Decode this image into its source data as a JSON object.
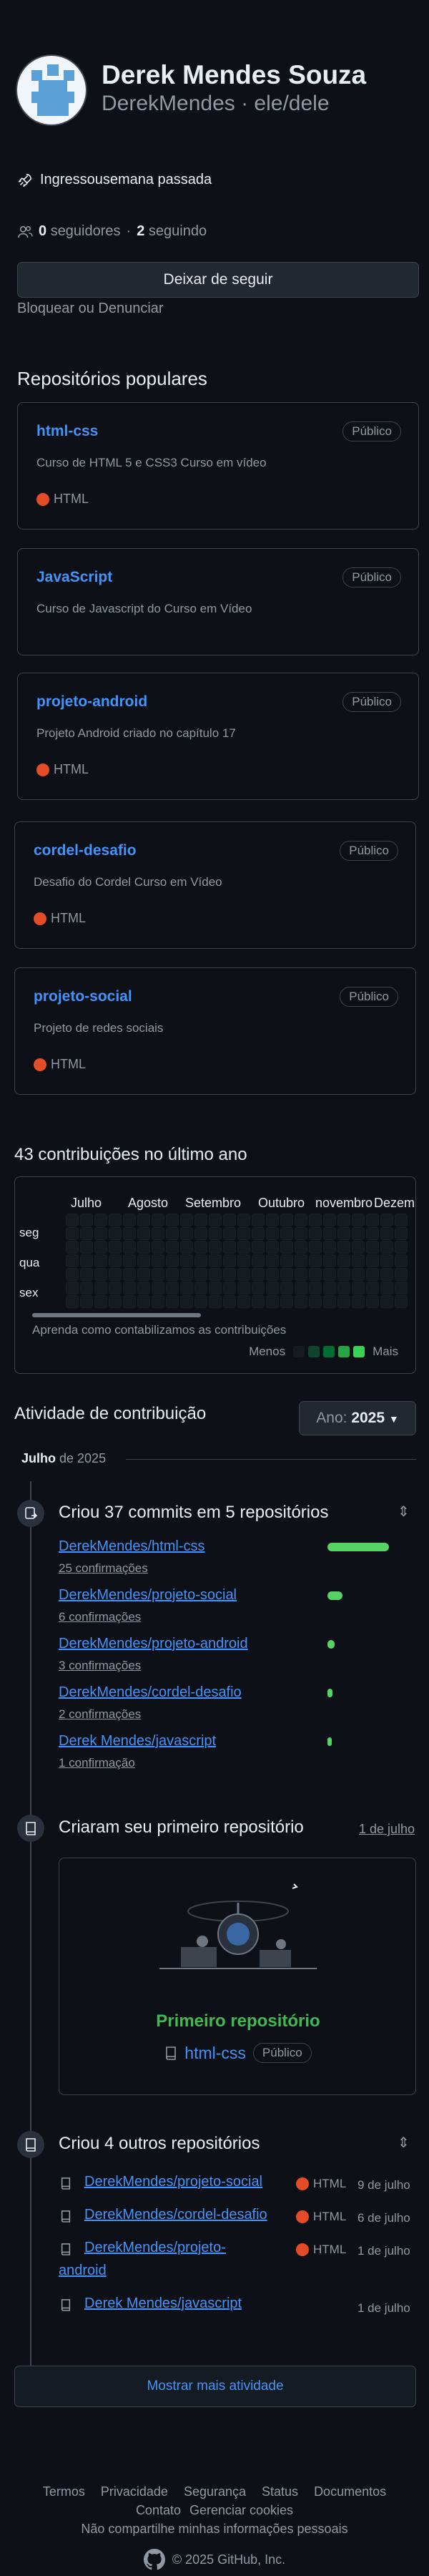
{
  "profile": {
    "name": "Derek Mendes Souza",
    "username_line": "DerekMendes · ele/dele",
    "joined_text": "Ingressousemana passada",
    "followers_count": "0",
    "followers_label": "seguidores",
    "following_count": "2",
    "following_label": "seguindo",
    "unfollow_label": "Deixar de seguir",
    "block_label": "Bloquear ou Denunciar"
  },
  "popular": {
    "heading": "Repositórios populares",
    "repos": [
      {
        "name": "html-css",
        "desc": "Curso de HTML 5 e CSS3 Curso em vídeo",
        "badge": "Público",
        "lang": "HTML"
      },
      {
        "name": "JavaScript",
        "desc": "Curso de Javascript do Curso em Vídeo",
        "badge": "Público",
        "lang": ""
      },
      {
        "name": "projeto-android",
        "desc": "Projeto Android criado no capítulo 17",
        "badge": "Público",
        "lang": "HTML"
      },
      {
        "name": "cordel-desafio",
        "desc": "Desafio do Cordel Curso em Vídeo",
        "badge": "Público",
        "lang": "HTML"
      },
      {
        "name": "projeto-social",
        "desc": "Projeto de redes sociais",
        "badge": "Público",
        "lang": "HTML"
      }
    ]
  },
  "contributions": {
    "heading": "43 contribuições no último ano",
    "months": [
      "Julho",
      "Agosto",
      "Setembro",
      "Outubro",
      "novembro",
      "Dezembro"
    ],
    "days": [
      "seg",
      "qua",
      "sex"
    ],
    "learn_link": "Aprenda como contabilizamos as contribuições",
    "less": "Menos",
    "more": "Mais",
    "legend_colors": [
      "#161b22",
      "#0e4429",
      "#006d32",
      "#26a641",
      "#39d353"
    ]
  },
  "activity": {
    "heading": "Atividade de contribuição",
    "year_label": "Ano:",
    "year_value": "2025",
    "month_bold": "Julho",
    "month_rest": "de 2025",
    "commits_title": "Criou 37 commits em 5 repositórios",
    "commits": [
      {
        "repo": "DerekMendes/html-css",
        "count": "25 confirmações",
        "value": 25
      },
      {
        "repo": "DerekMendes/projeto-social",
        "count": "6 confirmações",
        "value": 6
      },
      {
        "repo": "DerekMendes/projeto-android",
        "count": "3 confirmações",
        "value": 3
      },
      {
        "repo": "DerekMendes/cordel-desafio",
        "count": "2 confirmações",
        "value": 2
      },
      {
        "repo": "Derek Mendes/javascript",
        "count": "1 confirmação",
        "value": 1
      }
    ],
    "first_repo_title": "Criaram seu primeiro repositório",
    "first_repo_date": "1 de julho",
    "first_repo_caption": "Primeiro repositório",
    "first_repo_name": "html-css",
    "first_repo_badge": "Público",
    "others_title": "Criou 4 outros repositórios",
    "others": [
      {
        "repo": "DerekMendes/projeto-social",
        "lang": "HTML",
        "date": "9 de julho"
      },
      {
        "repo": "DerekMendes/cordel-desafio",
        "lang": "HTML",
        "date": "6 de julho"
      },
      {
        "repo_line1": "DerekMendes/projeto-",
        "repo_line2": "android",
        "lang": "HTML",
        "date": "1 de julho"
      },
      {
        "repo": "Derek Mendes/javascript",
        "lang": "",
        "date": "1 de julho"
      }
    ],
    "show_more": "Mostrar mais atividade"
  },
  "footer": {
    "line1": [
      "Termos",
      "Privacidade",
      "Segurança",
      "Status",
      "Documentos"
    ],
    "line2": [
      "Contato",
      "Gerenciar cookies"
    ],
    "line3": "Não compartilhe minhas informações pessoais",
    "copyright": "© 2025 GitHub, Inc."
  },
  "colors": {
    "accent": "#4493f8",
    "html": "#e34c26",
    "green": "#56d364",
    "bg": "#0d1117"
  }
}
